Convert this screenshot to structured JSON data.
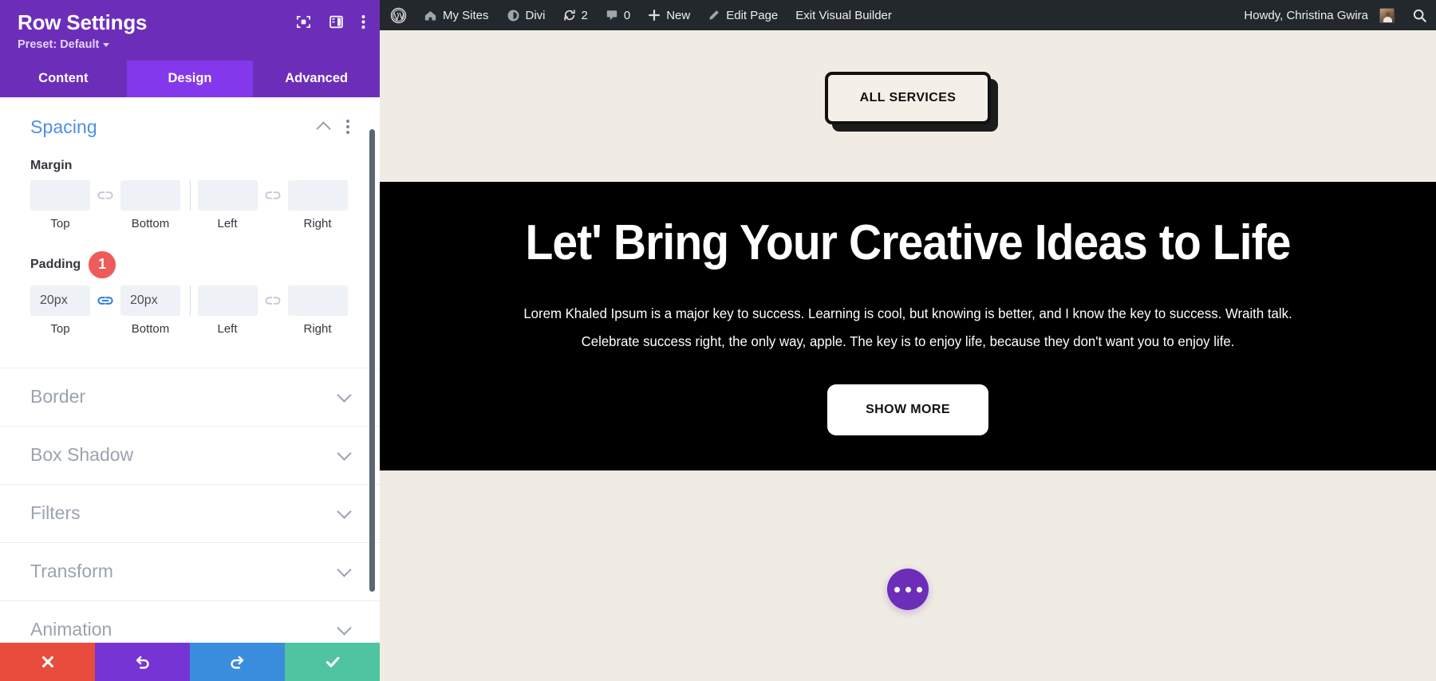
{
  "settings_panel": {
    "title": "Row Settings",
    "preset_label": "Preset: Default",
    "header_icons": [
      {
        "name": "focus-target-icon",
        "glyph": "focus"
      },
      {
        "name": "panel-layout-icon",
        "glyph": "layout"
      },
      {
        "name": "more-options-icon",
        "glyph": "kebab"
      }
    ],
    "tabs": [
      {
        "label": "Content",
        "active": false
      },
      {
        "label": "Design",
        "active": true
      },
      {
        "label": "Advanced",
        "active": false
      }
    ],
    "spacing": {
      "title": "Spacing",
      "margin": {
        "label": "Margin",
        "fields": [
          {
            "caption": "Top",
            "value": "",
            "placeholder": ""
          },
          {
            "caption": "Bottom",
            "value": "",
            "placeholder": ""
          },
          {
            "caption": "Left",
            "value": "",
            "placeholder": ""
          },
          {
            "caption": "Right",
            "value": "",
            "placeholder": ""
          }
        ],
        "link_left_linked": false,
        "link_right_linked": false
      },
      "padding": {
        "label": "Padding",
        "badge": "1",
        "badge_color": "#ef5a5a",
        "fields": [
          {
            "caption": "Top",
            "value": "20px",
            "placeholder": ""
          },
          {
            "caption": "Bottom",
            "value": "20px",
            "placeholder": ""
          },
          {
            "caption": "Left",
            "value": "",
            "placeholder": ""
          },
          {
            "caption": "Right",
            "value": "",
            "placeholder": ""
          }
        ],
        "link_left_linked": true,
        "link_right_linked": false
      }
    },
    "accordions": [
      {
        "label": "Border"
      },
      {
        "label": "Box Shadow"
      },
      {
        "label": "Filters"
      },
      {
        "label": "Transform"
      },
      {
        "label": "Animation"
      }
    ],
    "footer_buttons": [
      {
        "name": "cancel-button",
        "icon": "close-icon",
        "color": "#e74c3c"
      },
      {
        "name": "undo-button",
        "icon": "undo-icon",
        "color": "#7734d4"
      },
      {
        "name": "redo-button",
        "icon": "redo-icon",
        "color": "#3a8ddd"
      },
      {
        "name": "save-button",
        "icon": "check-icon",
        "color": "#4fc4a0"
      }
    ],
    "accent_purple": "#6c2eb9",
    "tab_active_purple": "#8338ec",
    "section_title_blue": "#4e8ee8"
  },
  "admin_bar": {
    "items": [
      {
        "name": "wordpress-logo",
        "label": "",
        "icon": "wordpress-icon"
      },
      {
        "name": "my-sites",
        "label": "My Sites",
        "icon": "sites-icon"
      },
      {
        "name": "divi",
        "label": "Divi",
        "icon": "divi-icon"
      },
      {
        "name": "updates",
        "label": "2",
        "icon": "updates-icon"
      },
      {
        "name": "comments",
        "label": "0",
        "icon": "comment-icon"
      },
      {
        "name": "new-content",
        "label": "New",
        "icon": "plus-icon"
      },
      {
        "name": "edit-page",
        "label": "Edit Page",
        "icon": "pencil-icon"
      },
      {
        "name": "exit-visual-builder",
        "label": "Exit Visual Builder",
        "icon": ""
      }
    ],
    "howdy": "Howdy, Christina Gwira",
    "search_icon": "search-icon",
    "background": "#23282d"
  },
  "page": {
    "services_button": "ALL SERVICES",
    "heading": "Let' Bring Your Creative Ideas to Life",
    "paragraph": "Lorem Khaled Ipsum is a major key to success. Learning is cool, but knowing is better, and I know the key to success. Wraith talk. Celebrate success right, the only way, apple. The key is to enjoy life, because they don't want you to enjoy life.",
    "show_more_button": "SHOW MORE",
    "fab_icon": "ellipsis-icon",
    "bg_cream": "#f0ece3",
    "bg_dark": "#000000"
  }
}
